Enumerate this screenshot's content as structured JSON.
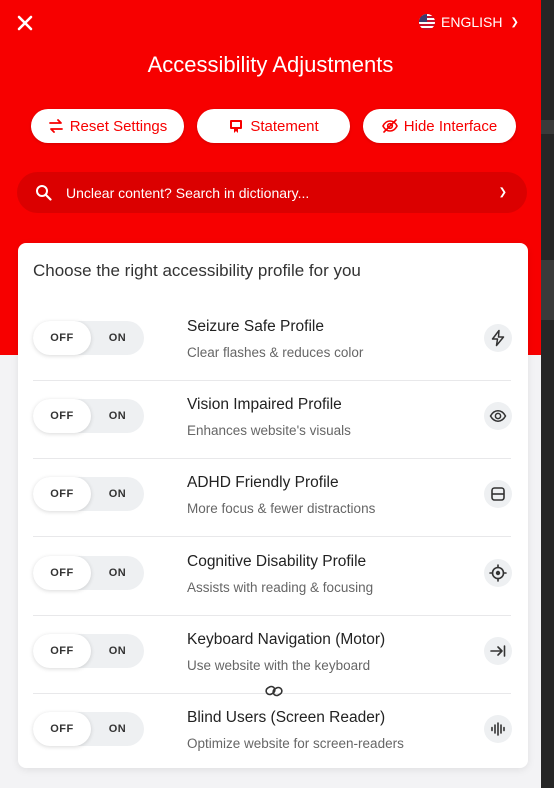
{
  "header": {
    "title": "Accessibility Adjustments",
    "language_label": "ENGLISH",
    "language_flag_icon": "us-flag-icon",
    "close_icon": "close-icon"
  },
  "actions": [
    {
      "label": "Reset Settings",
      "icon": "reset-icon"
    },
    {
      "label": "Statement",
      "icon": "statement-icon"
    },
    {
      "label": "Hide Interface",
      "icon": "eye-off-icon"
    }
  ],
  "search": {
    "placeholder": "Unclear content? Search in dictionary..."
  },
  "profiles": {
    "heading": "Choose the right accessibility profile for you",
    "toggle_off_label": "OFF",
    "toggle_on_label": "ON",
    "items": [
      {
        "name": "Seizure Safe Profile",
        "description": "Clear flashes & reduces color",
        "icon": "lightning-icon",
        "state": "off"
      },
      {
        "name": "Vision Impaired Profile",
        "description": "Enhances website's visuals",
        "icon": "eye-icon",
        "state": "off"
      },
      {
        "name": "ADHD Friendly Profile",
        "description": "More focus & fewer distractions",
        "icon": "layout-icon",
        "state": "off"
      },
      {
        "name": "Cognitive Disability Profile",
        "description": "Assists with reading & focusing",
        "icon": "target-icon",
        "state": "off"
      },
      {
        "name": "Keyboard Navigation (Motor)",
        "description": "Use website with the keyboard",
        "icon": "tab-arrow-icon",
        "state": "off"
      },
      {
        "name": "Blind Users (Screen Reader)",
        "description": "Optimize website for screen-readers",
        "icon": "audio-wave-icon",
        "state": "off"
      }
    ]
  },
  "colors": {
    "accent": "#f70000",
    "search_bg": "#db0000",
    "panel_bg": "#f3f3f5"
  }
}
